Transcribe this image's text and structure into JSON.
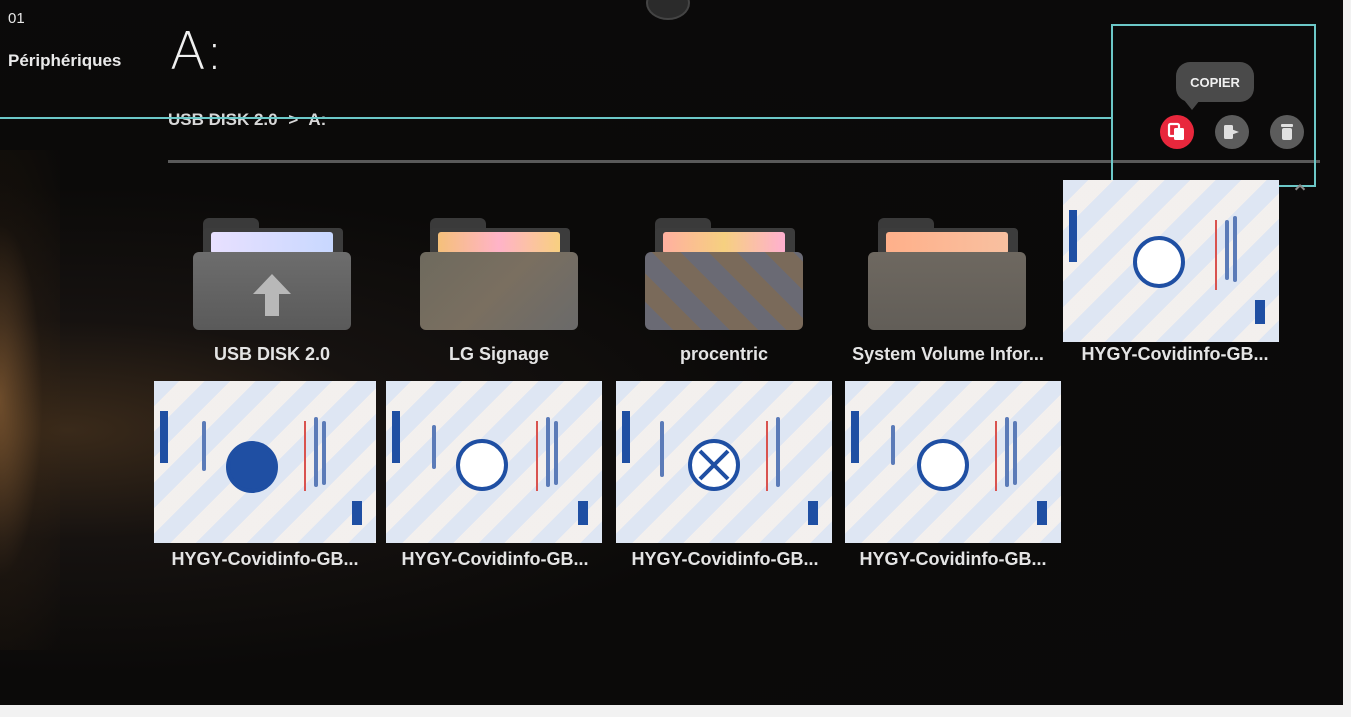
{
  "header": {
    "section_number": "01",
    "section_name": "Périphériques",
    "drive": "A:",
    "breadcrumb": [
      "USB DISK 2.0",
      ">",
      "A:"
    ]
  },
  "actions": {
    "tooltip": "COPIER",
    "buttons": [
      {
        "name": "copy",
        "icon": "copy-icon",
        "active": true
      },
      {
        "name": "move",
        "icon": "move-icon",
        "active": false
      },
      {
        "name": "delete",
        "icon": "trash-icon",
        "active": false
      }
    ]
  },
  "colors": {
    "accent_active": "#e8273c",
    "highlight_box": "#6cc8c8",
    "button_idle": "#5c5c5c"
  },
  "items": [
    {
      "label": "USB DISK 2.0",
      "type": "parent-folder"
    },
    {
      "label": "LG Signage",
      "type": "folder"
    },
    {
      "label": "procentric",
      "type": "folder"
    },
    {
      "label": "System Volume Infor...",
      "type": "folder"
    },
    {
      "label": "HYGY-Covidinfo-GB...",
      "type": "image"
    },
    {
      "label": "HYGY-Covidinfo-GB...",
      "type": "image"
    },
    {
      "label": "HYGY-Covidinfo-GB...",
      "type": "image"
    },
    {
      "label": "HYGY-Covidinfo-GB...",
      "type": "image"
    },
    {
      "label": "HYGY-Covidinfo-GB...",
      "type": "image"
    }
  ]
}
